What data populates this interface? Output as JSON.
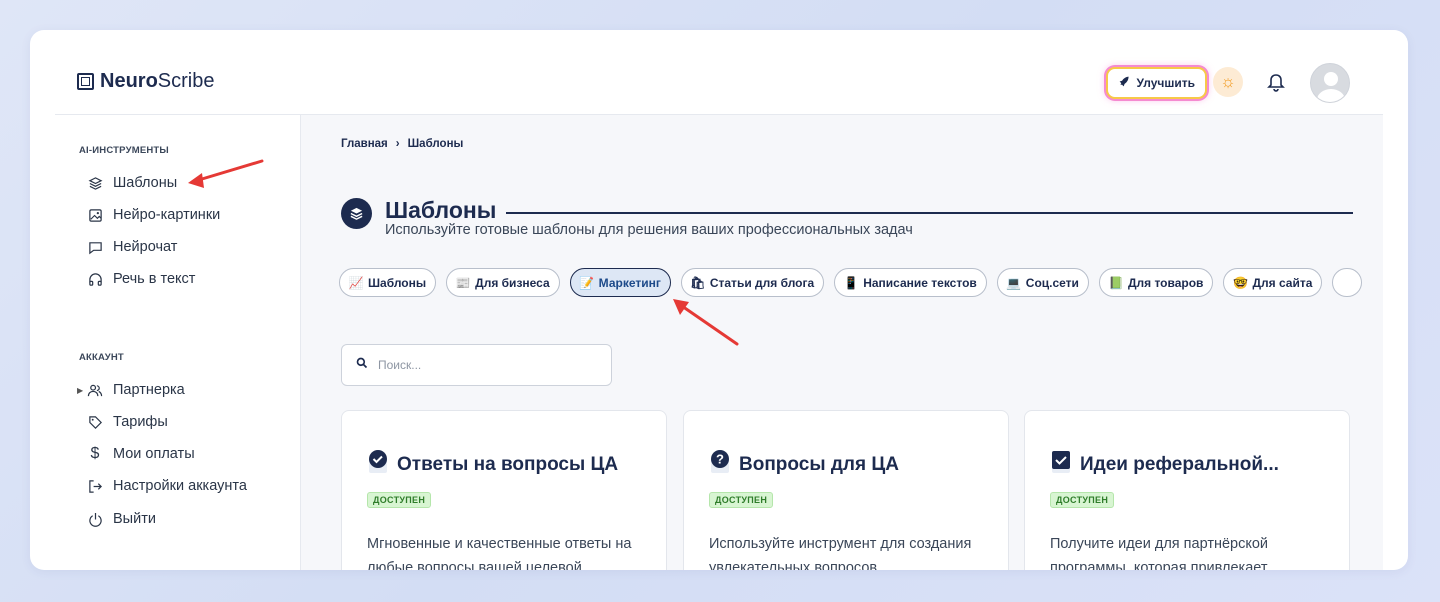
{
  "brand": {
    "name_bold": "Neuro",
    "name_light": "Scribe"
  },
  "header": {
    "upgrade_label": "Улучшить"
  },
  "sidebar": {
    "section_tools": "AI-ИНСТРУМЕНТЫ",
    "tools": [
      {
        "label": "Шаблоны",
        "icon": "layers-icon"
      },
      {
        "label": "Нейро-картинки",
        "icon": "image-icon"
      },
      {
        "label": "Нейрочат",
        "icon": "chat-icon"
      },
      {
        "label": "Речь в текст",
        "icon": "headphones-icon"
      }
    ],
    "section_account": "АККАУНТ",
    "account": [
      {
        "label": "Партнерка",
        "icon": "users-icon"
      },
      {
        "label": "Тарифы",
        "icon": "tag-icon"
      },
      {
        "label": "Мои оплаты",
        "icon": "dollar-icon"
      },
      {
        "label": "Настройки аккаунта",
        "icon": "login-icon"
      },
      {
        "label": "Выйти",
        "icon": "power-icon"
      }
    ]
  },
  "breadcrumb": {
    "home": "Главная",
    "separator": "›",
    "current": "Шаблоны"
  },
  "page": {
    "title": "Шаблоны",
    "subtitle": "Используйте готовые шаблоны для решения ваших профессиональных задач"
  },
  "chips": [
    {
      "label": "Шаблоны",
      "emoji": "📈"
    },
    {
      "label": "Для бизнеса",
      "emoji": "📰"
    },
    {
      "label": "Маркетинг",
      "emoji": "📝",
      "active": true
    },
    {
      "label": "Статьи для блога",
      "emoji": "🛍"
    },
    {
      "label": "Написание текстов",
      "emoji": "📱"
    },
    {
      "label": "Соц.сети",
      "emoji": "💻"
    },
    {
      "label": "Для товаров",
      "emoji": "📗"
    },
    {
      "label": "Для сайта",
      "emoji": "🤓"
    }
  ],
  "search": {
    "placeholder": "Поиск..."
  },
  "cards": [
    {
      "title": "Ответы на вопросы ЦА",
      "badge": "ДОСТУПЕН",
      "desc": "Мгновенные и качественные ответы на любые вопросы вашей целевой"
    },
    {
      "title": "Вопросы для ЦА",
      "badge": "ДОСТУПЕН",
      "desc": "Используйте инструмент для создания увлекательных вопросов"
    },
    {
      "title": "Идеи реферальной...",
      "badge": "ДОСТУПЕН",
      "desc": "Получите идеи для партнёрской программы, которая привлекает"
    }
  ],
  "colors": {
    "brand_dark": "#1d2b4f",
    "badge_green": "#d8f5d2",
    "annotation_red": "#e53935"
  }
}
